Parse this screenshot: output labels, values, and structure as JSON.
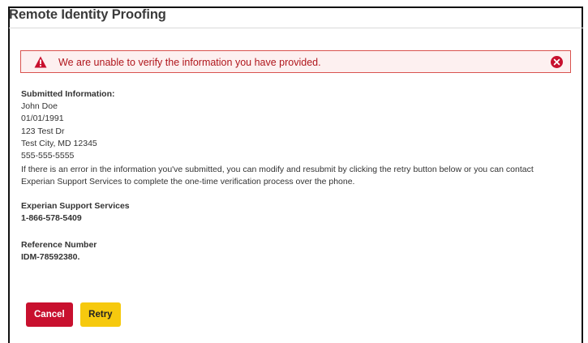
{
  "page": {
    "title": "Remote Identity Proofing"
  },
  "alert": {
    "message": "We are unable to verify the information you have provided.",
    "icon": "warning-triangle-icon",
    "close_icon": "close-circle-icon",
    "color": "#c8102e"
  },
  "submitted": {
    "heading": "Submitted Information:",
    "name": "John Doe",
    "dob": "01/01/1991",
    "street": "123 Test Dr",
    "city_state_zip": "Test City, MD 12345",
    "phone": "555-555-5555",
    "instructions": "If there is an error in the information you've submitted, you can modify and resubmit by clicking the retry button below or you can contact Experian Support Services to complete the one-time verification process over the phone."
  },
  "support": {
    "heading": "Experian Support Services",
    "phone": "1-866-578-5409"
  },
  "reference": {
    "heading": "Reference Number",
    "number": "IDM-78592380."
  },
  "buttons": {
    "cancel_label": "Cancel",
    "retry_label": "Retry",
    "cancel_color": "#c8102e",
    "retry_color": "#f6c90e"
  }
}
